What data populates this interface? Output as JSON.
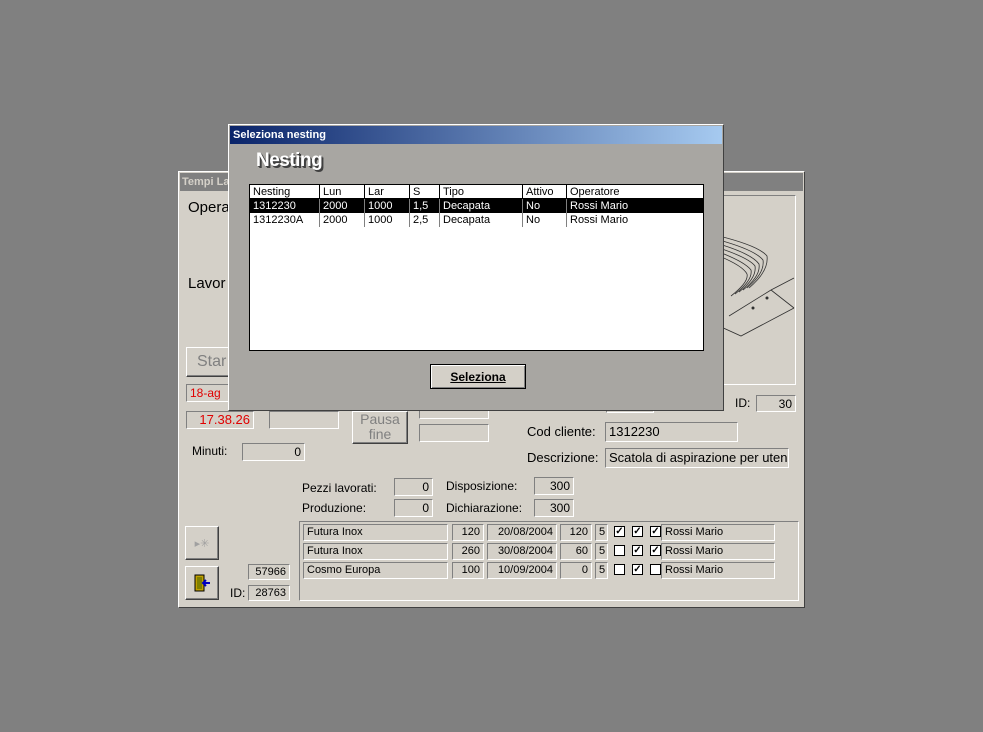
{
  "background_window": {
    "title": "Tempi La",
    "operator_label": "Opera",
    "lavor_label": "Lavor",
    "start_label": "Star",
    "date_value": "18-ag",
    "time_value": "17.38.26",
    "pausa_fine_label": "Pausa\nfine",
    "minuti_label": "Minuti:",
    "minuti_value": "0",
    "id_label": "ID:",
    "id_value": "30",
    "cod_cliente_label": "Cod cliente:",
    "cod_cliente_value": "1312230",
    "descrizione_label": "Descrizione:",
    "descrizione_value": "Scatola di aspirazione per uten",
    "pezzi_lavorati_label": "Pezzi lavorati:",
    "pezzi_lavorati_value": "0",
    "produzione_label": "Produzione:",
    "produzione_value": "0",
    "disposizione_label": "Disposizione:",
    "disposizione_value": "300",
    "dichiarazione_label": "Dichiarazione:",
    "dichiarazione_value": "300",
    "counter_value": "57966",
    "bottom_id_label": "ID:",
    "bottom_id_value": "28763",
    "orders": [
      {
        "cliente": "Futura Inox",
        "qta": "120",
        "data": "20/08/2004",
        "n": "120",
        "k": "5",
        "c1": true,
        "c2": true,
        "c3": true,
        "operatore": "Rossi Mario"
      },
      {
        "cliente": "Futura Inox",
        "qta": "260",
        "data": "30/08/2004",
        "n": "60",
        "k": "5",
        "c1": false,
        "c2": true,
        "c3": true,
        "operatore": "Rossi Mario"
      },
      {
        "cliente": "Cosmo Europa",
        "qta": "100",
        "data": "10/09/2004",
        "n": "0",
        "k": "5",
        "c1": false,
        "c2": true,
        "c3": false,
        "operatore": "Rossi Mario"
      }
    ]
  },
  "dialog": {
    "title": "Seleziona nesting",
    "heading": "Nesting",
    "columns": [
      "Nesting",
      "Lun",
      "Lar",
      "S",
      "Tipo",
      "Attivo",
      "Operatore"
    ],
    "rows": [
      {
        "nesting": "1312230",
        "lun": "2000",
        "lar": "1000",
        "s": "1,5",
        "tipo": "Decapata",
        "attivo": "No",
        "operatore": "Rossi Mario",
        "selected": true
      },
      {
        "nesting": "1312230A",
        "lun": "2000",
        "lar": "1000",
        "s": "2,5",
        "tipo": "Decapata",
        "attivo": "No",
        "operatore": "Rossi Mario",
        "selected": false
      }
    ],
    "select_button_label": "Seleziona"
  }
}
